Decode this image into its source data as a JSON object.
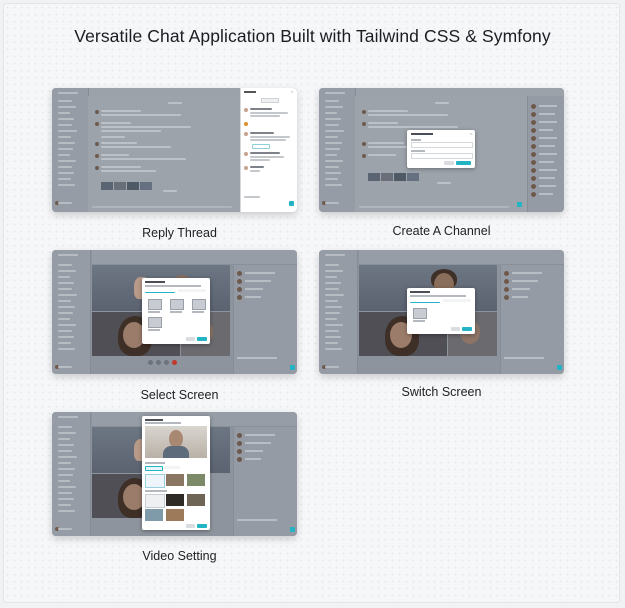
{
  "page": {
    "title": "Versatile Chat Application Built with Tailwind CSS & Symfony"
  },
  "screens": [
    {
      "id": "reply-thread",
      "caption": "Reply Thread"
    },
    {
      "id": "create-channel",
      "caption": "Create A Channel"
    },
    {
      "id": "select-screen",
      "caption": "Select Screen"
    },
    {
      "id": "switch-screen",
      "caption": "Switch  Screen"
    },
    {
      "id": "video-setting",
      "caption": "Video Setting"
    }
  ],
  "colors": {
    "accent": "#22b3c4",
    "overlay": "#8e949d",
    "caption_text": "#222222"
  }
}
